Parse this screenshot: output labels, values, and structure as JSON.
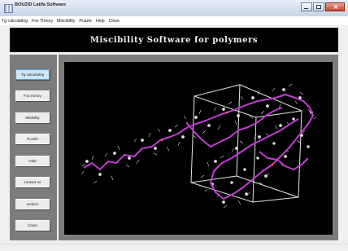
{
  "window": {
    "title": "BOUZID Latifa Software",
    "controls": [
      "minimize-icon",
      "maximize-icon",
      "close-icon"
    ]
  },
  "menu": [
    "Tg calculating",
    "Fox Theory",
    "Miscibility",
    "Puzzle",
    "Help",
    "Close"
  ],
  "header": {
    "title": "Miscibility Software for polymers"
  },
  "sidebar": {
    "buttons": [
      {
        "label": "Tg calculating",
        "active": true
      },
      {
        "label": "Fox theory",
        "active": false
      },
      {
        "label": "Misibility",
        "active": false
      },
      {
        "label": "Puzzle",
        "active": false
      },
      {
        "label": "Help",
        "active": false
      },
      {
        "label": "contact us",
        "active": false
      },
      {
        "label": "version",
        "active": false
      },
      {
        "label": "Close",
        "active": false
      }
    ]
  },
  "viewer": {
    "content": "polymer-molecule-3d",
    "background": "#000000",
    "backbone_color": "#c23ad2",
    "atom_color": "#d9d9d9",
    "cell_color": "#e6e6e6"
  }
}
